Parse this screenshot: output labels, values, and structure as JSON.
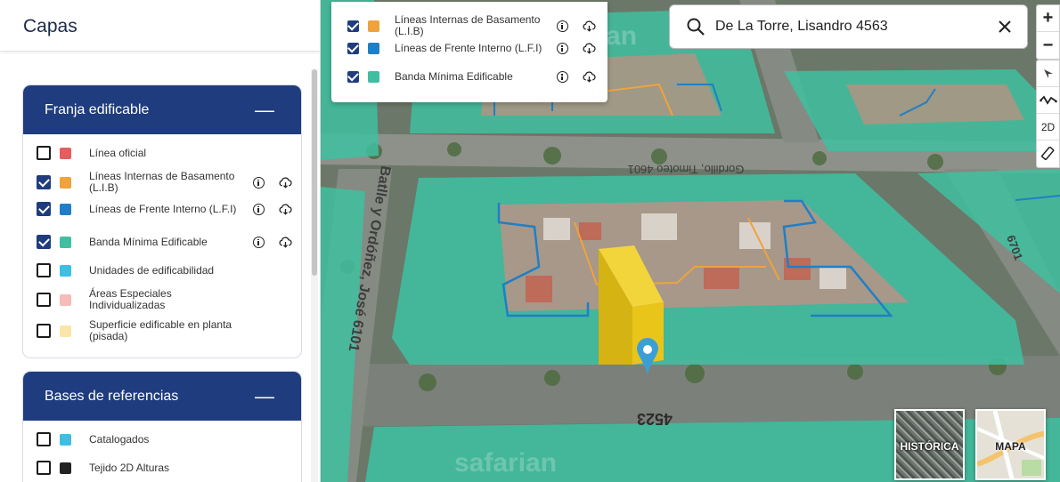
{
  "sidebar": {
    "title": "Capas",
    "sections": [
      {
        "title": "Franja edificable",
        "collapse_icon": "minus",
        "layers": [
          {
            "label": "Línea oficial",
            "checked": false,
            "color": "#e35f5f"
          },
          {
            "label": "Líneas Internas de Basamento (L.I.B)",
            "checked": true,
            "color": "#f0a23d"
          },
          {
            "label": "Líneas de Frente Interno (L.F.I)",
            "checked": true,
            "color": "#1f7fc6"
          },
          {
            "label": "Banda Mínima Edificable",
            "checked": true,
            "color": "#3fbfa0"
          },
          {
            "label": "Unidades de edificabilidad",
            "checked": false,
            "color": "#3cbfe3"
          },
          {
            "label": "Áreas Especiales Individualizadas",
            "checked": false,
            "color": "#f6bcb8"
          },
          {
            "label": "Superficie edificable en planta (pisada)",
            "checked": false,
            "color": "#fbe6a8"
          }
        ]
      },
      {
        "title": "Bases de referencias",
        "collapse_icon": "minus",
        "layers": [
          {
            "label": "Catalogados",
            "checked": false,
            "color": "#3cbfe3"
          },
          {
            "label": "Tejido 2D Alturas",
            "checked": false,
            "color": "#222222"
          }
        ]
      }
    ]
  },
  "legend": {
    "items": [
      {
        "label": "Líneas Internas de Basamento (L.I.B)",
        "checked": true,
        "color": "#f0a23d"
      },
      {
        "label": "Líneas de Frente Interno (L.F.I)",
        "checked": true,
        "color": "#1f7fc6"
      },
      {
        "label": "Banda Mínima Edificable",
        "checked": true,
        "color": "#3fbfa0"
      }
    ]
  },
  "search": {
    "value": "De La Torre, Lisandro 4563",
    "placeholder": ""
  },
  "map_tools": {
    "zoom_in": "+",
    "zoom_out": "−",
    "view_2d": "2D"
  },
  "street_labels": {
    "top": "Gordillo, Timoteo 4601",
    "left": "Batlle y Ordóñez, José 6101",
    "bottom": "4523",
    "right": "6701"
  },
  "basemaps": {
    "historic": "HISTÓRICA",
    "map": "MAPA"
  },
  "watermark": "safarian",
  "colors": {
    "header_blue": "#1f3d7e",
    "band": "#3fbfa0",
    "lib": "#f0a23d",
    "lfi": "#1f7fc6",
    "building": "#e9c519",
    "marker": "#3a9fd6"
  }
}
